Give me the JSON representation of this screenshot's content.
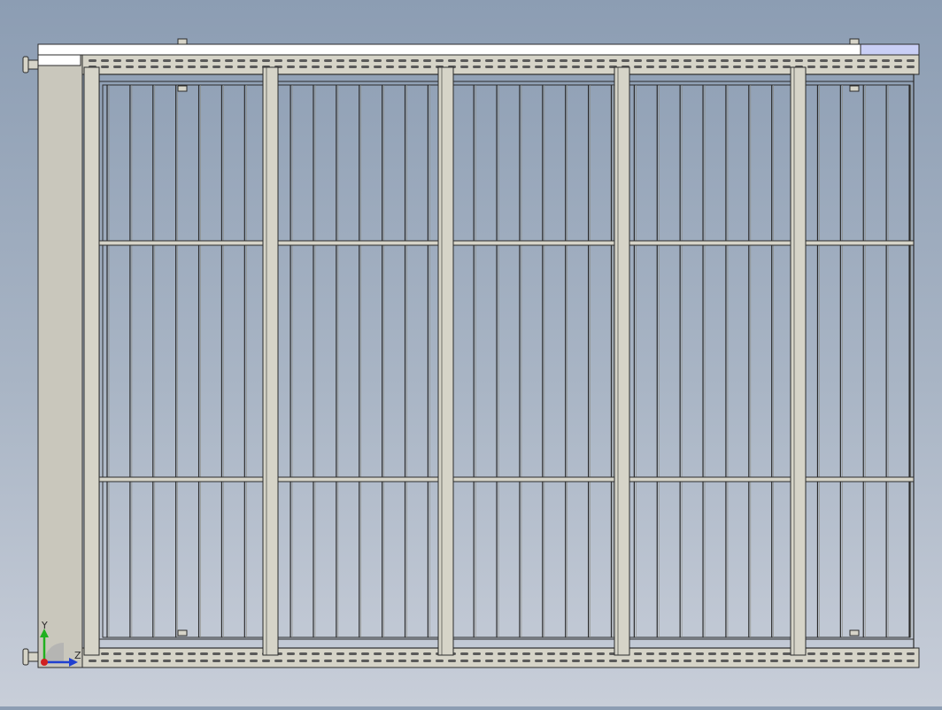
{
  "view": {
    "title": "",
    "background_top": "#8c9db3",
    "background_bottom": "#c8ced9"
  },
  "model": {
    "frame_color": "#d6d4c8",
    "edge_color": "#2b2b2b",
    "panel_color": "#c9c7bc",
    "top_strip_color": "#ffffff",
    "accent_color": "#c9cff5",
    "vertical_posts": 5,
    "grid_bars": 36,
    "horizontal_bars": 2
  },
  "triad": {
    "x_label": "",
    "y_label": "Y",
    "z_label": "Z",
    "y_color": "#20b020",
    "z_color": "#2040d0",
    "origin_color": "#d02020"
  }
}
